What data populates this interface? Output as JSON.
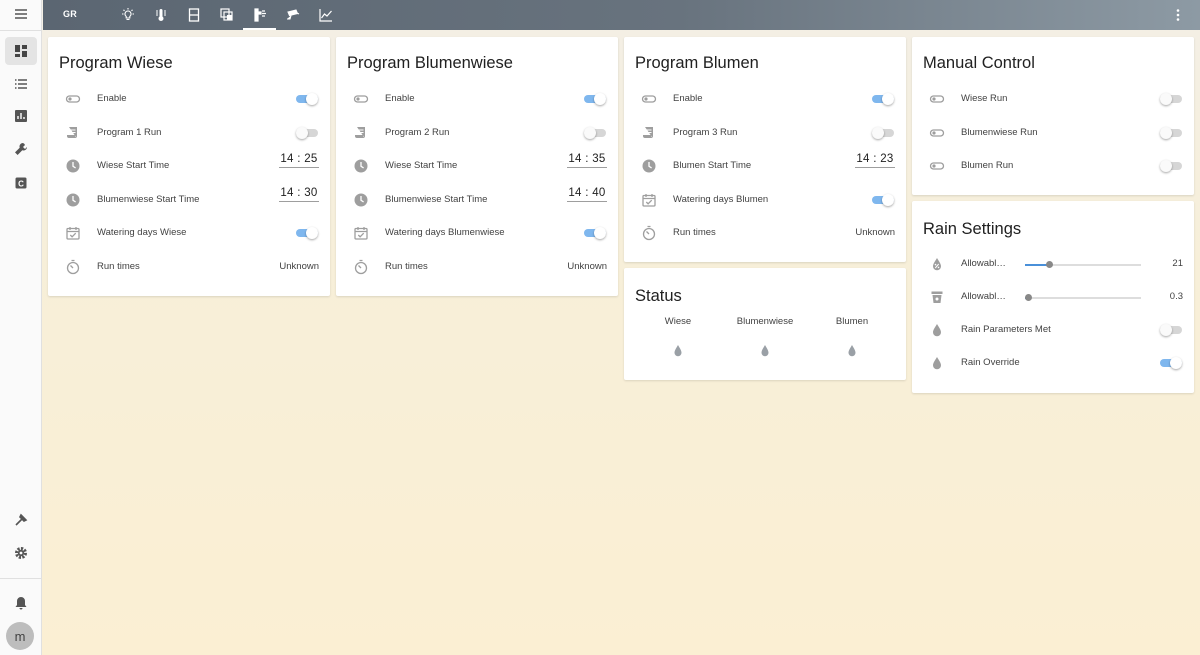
{
  "topbar": {
    "logo": "GR",
    "tabs": [
      "lightbulb-icon",
      "thermometer-icon",
      "door-icon",
      "layers-icon",
      "sprinkler-icon",
      "cctv-icon",
      "chart-line-icon"
    ],
    "active_tab": 4
  },
  "sidebar": {
    "items": [
      "dashboard-icon",
      "list-icon",
      "chart-icon",
      "wrench-icon",
      "config-icon"
    ],
    "bottom": [
      "hammer-icon",
      "gear-icon",
      "bell-icon"
    ],
    "avatar": "m"
  },
  "cards": {
    "wiese": {
      "title": "Program Wiese",
      "rows": [
        {
          "label": "Enable",
          "type": "toggle",
          "on": true,
          "icon": "toggle-switch-icon"
        },
        {
          "label": "Program 1 Run",
          "type": "toggle",
          "on": false,
          "icon": "script-icon"
        },
        {
          "label": "Wiese Start Time",
          "type": "time",
          "value": "14 : 25",
          "icon": "clock-icon"
        },
        {
          "label": "Blumenwiese Start Time",
          "type": "time",
          "value": "14 : 30",
          "icon": "clock-icon"
        },
        {
          "label": "Watering days Wiese",
          "type": "toggle",
          "on": true,
          "icon": "calendar-check-icon"
        },
        {
          "label": "Run times",
          "type": "text",
          "value": "Unknown",
          "icon": "timer-icon"
        }
      ]
    },
    "blumenwiese": {
      "title": "Program Blumenwiese",
      "rows": [
        {
          "label": "Enable",
          "type": "toggle",
          "on": true,
          "icon": "toggle-switch-icon"
        },
        {
          "label": "Program 2 Run",
          "type": "toggle",
          "on": false,
          "icon": "script-icon"
        },
        {
          "label": "Wiese Start Time",
          "type": "time",
          "value": "14 : 35",
          "icon": "clock-icon"
        },
        {
          "label": "Blumenwiese Start Time",
          "type": "time",
          "value": "14 : 40",
          "icon": "clock-icon"
        },
        {
          "label": "Watering days Blumenwiese",
          "type": "toggle",
          "on": true,
          "icon": "calendar-check-icon"
        },
        {
          "label": "Run times",
          "type": "text",
          "value": "Unknown",
          "icon": "timer-icon"
        }
      ]
    },
    "blumen": {
      "title": "Program Blumen",
      "rows": [
        {
          "label": "Enable",
          "type": "toggle",
          "on": true,
          "icon": "toggle-switch-icon"
        },
        {
          "label": "Program 3 Run",
          "type": "toggle",
          "on": false,
          "icon": "script-icon"
        },
        {
          "label": "Blumen Start Time",
          "type": "time",
          "value": "14 : 23",
          "icon": "clock-icon"
        },
        {
          "label": "Watering days Blumen",
          "type": "toggle",
          "on": true,
          "icon": "calendar-check-icon"
        },
        {
          "label": "Run times",
          "type": "text",
          "value": "Unknown",
          "icon": "timer-icon"
        }
      ]
    },
    "manual": {
      "title": "Manual Control",
      "rows": [
        {
          "label": "Wiese Run",
          "type": "toggle",
          "on": false,
          "icon": "toggle-switch-icon"
        },
        {
          "label": "Blumenwiese Run",
          "type": "toggle",
          "on": false,
          "icon": "toggle-switch-icon"
        },
        {
          "label": "Blumen Run",
          "type": "toggle",
          "on": false,
          "icon": "toggle-switch-icon"
        }
      ]
    },
    "status": {
      "title": "Status",
      "columns": [
        "Wiese",
        "Blumenwiese",
        "Blumen"
      ]
    },
    "rain": {
      "title": "Rain Settings",
      "sliders": [
        {
          "label": "Allowable Rain",
          "value": "21",
          "fraction": 0.21,
          "icon": "water-percent-icon"
        },
        {
          "label": "Allowable Rain Amount",
          "value": "0.3",
          "fraction": 0.03,
          "icon": "bucket-icon"
        }
      ],
      "rows": [
        {
          "label": "Rain Parameters Met",
          "type": "toggle",
          "on": false,
          "icon": "water-drop-icon"
        },
        {
          "label": "Rain Override",
          "type": "toggle",
          "on": true,
          "icon": "water-drop-icon"
        }
      ]
    }
  }
}
